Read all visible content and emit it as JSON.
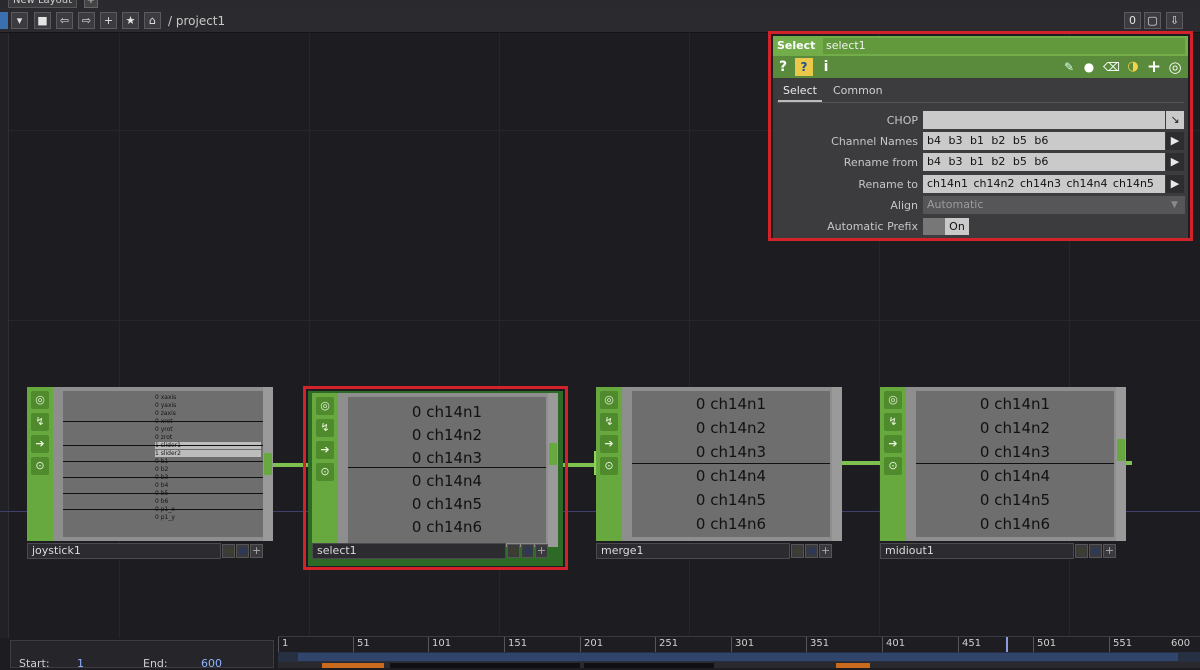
{
  "window": {
    "layout_tab": "New Layout",
    "path": "/ project1"
  },
  "toolbar": {
    "menu_arrow": "▾",
    "stop": "■",
    "back": "⇦",
    "forward": "⇨",
    "add": "+",
    "bookmark": "★",
    "home": "⌂",
    "right_value": "0",
    "right_square": "▢",
    "right_pin": "⇩"
  },
  "nodes": {
    "joystick1": {
      "name": "joystick1",
      "channels": [
        "0 xaxis",
        "0 yaxis",
        "0 zaxis",
        "0 xrot",
        "0 yrot",
        "0 zrot",
        "1 slider1",
        "1 slider2",
        "0 b1",
        "0 b2",
        "0 b3",
        "0 b4",
        "0 b5",
        "0 b6",
        "0 p1_x",
        "0 p1_y"
      ]
    },
    "select1": {
      "name": "select1",
      "channels": [
        "0 ch14n1",
        "0 ch14n2",
        "0 ch14n3",
        "0 ch14n4",
        "0 ch14n5",
        "0 ch14n6"
      ]
    },
    "merge1": {
      "name": "merge1",
      "channels": [
        "0 ch14n1",
        "0 ch14n2",
        "0 ch14n3",
        "0 ch14n4",
        "0 ch14n5",
        "0 ch14n6"
      ]
    },
    "midiout1": {
      "name": "midiout1",
      "channels": [
        "0 ch14n1",
        "0 ch14n2",
        "0 ch14n3",
        "0 ch14n4",
        "0 ch14n5",
        "0 ch14n6"
      ]
    }
  },
  "param_panel": {
    "op_type": "Select",
    "op_name": "select1",
    "tabs": {
      "select": "Select",
      "common": "Common"
    },
    "params": {
      "chop": {
        "label": "CHOP",
        "value": ""
      },
      "channel_names": {
        "label": "Channel Names",
        "value": "b4 b3 b1 b2 b5 b6"
      },
      "rename_from": {
        "label": "Rename from",
        "value": "b4 b3 b1 b2 b5 b6"
      },
      "rename_to": {
        "label": "Rename to",
        "value": "ch14n1 ch14n2 ch14n3 ch14n4 ch14n5"
      },
      "align": {
        "label": "Align",
        "value": "Automatic"
      },
      "automatic_prefix": {
        "label": "Automatic Prefix",
        "value": "On"
      }
    }
  },
  "timeline": {
    "ticks": [
      "1",
      "51",
      "101",
      "151",
      "201",
      "251",
      "301",
      "351",
      "401",
      "451",
      "501",
      "551",
      "600"
    ],
    "start_label": "Start:",
    "start_value": "1",
    "end_label": "End:",
    "end_value": "600"
  },
  "colors": {
    "chop_green": "#67a83f",
    "highlight_red": "#d2232a",
    "wire_green": "#7dc24e"
  }
}
